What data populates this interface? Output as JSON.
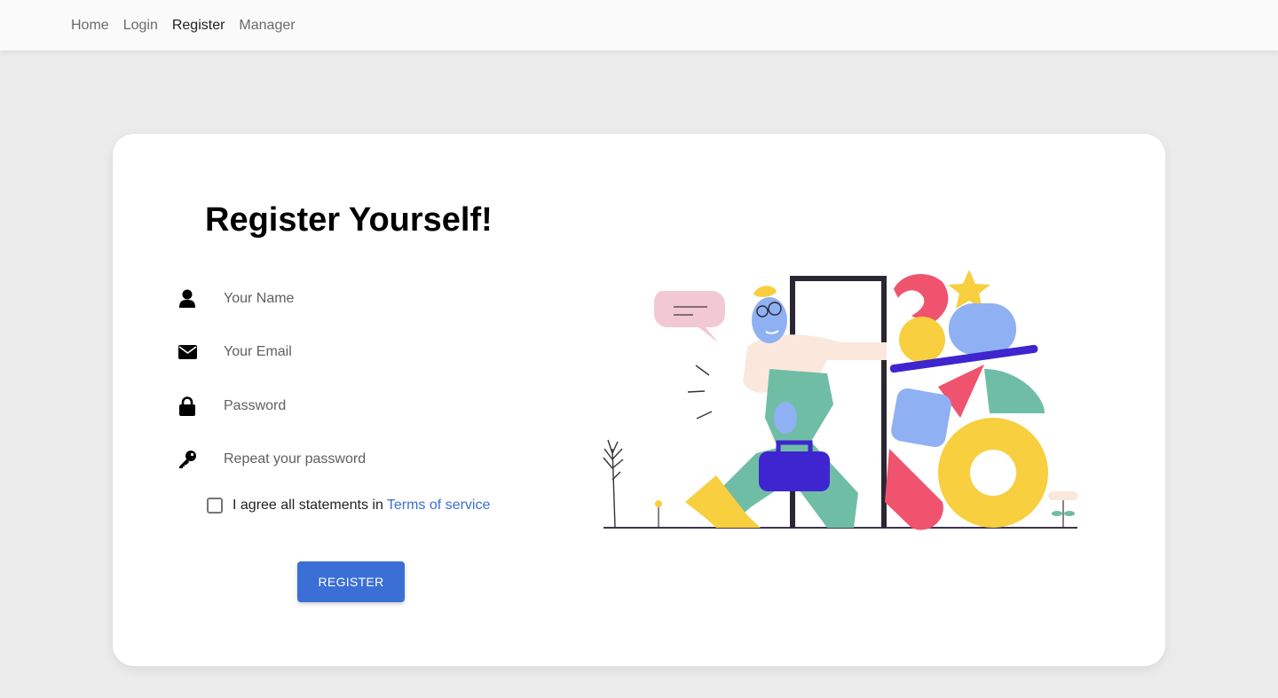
{
  "nav": {
    "items": [
      "Home",
      "Login",
      "Register",
      "Manager"
    ],
    "active": "Register"
  },
  "form": {
    "title": "Register Yourself!",
    "fields": [
      {
        "icon": "user-icon",
        "placeholder": "Your Name",
        "value": ""
      },
      {
        "icon": "envelope-icon",
        "placeholder": "Your Email",
        "value": ""
      },
      {
        "icon": "lock-icon",
        "placeholder": "Password",
        "value": ""
      },
      {
        "icon": "key-icon",
        "placeholder": "Repeat your password",
        "value": ""
      }
    ],
    "agree_text": "I agree all statements in",
    "terms_link": "Terms of service",
    "agree_checked": false,
    "submit_label": "REGISTER"
  },
  "colors": {
    "accent": "#3b6fd6",
    "link": "#3b6fd0",
    "page_bg": "#ececec",
    "card_bg": "#ffffff"
  }
}
